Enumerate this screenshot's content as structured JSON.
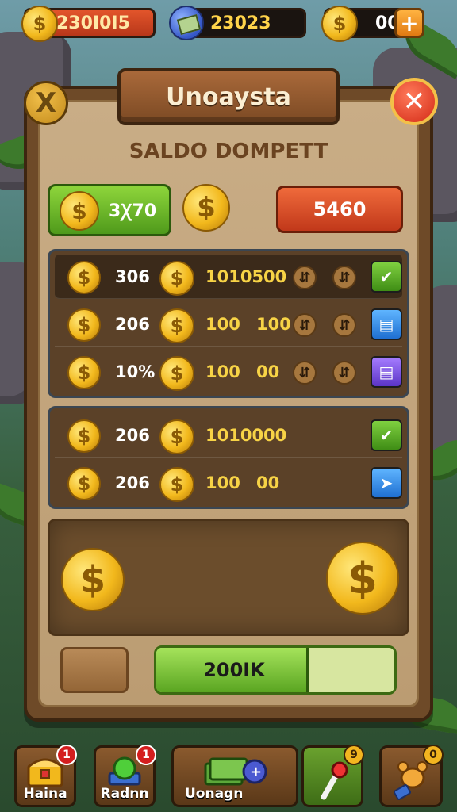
{
  "currencies": {
    "red_amount": "230I0I5",
    "gem_amount": "23023",
    "coin_amount": "00",
    "plus_label": "+"
  },
  "dialog": {
    "title": "Unoaysta",
    "subtitle": "SALDO DOMPETT",
    "close_left_label": "X",
    "close_right_label": "✕",
    "green_button_value": "3Ꭓ70",
    "red_button_value": "5460",
    "coin_symbol": "$"
  },
  "list_group_1": [
    {
      "amount": "306",
      "value": "1010500",
      "value_b": "",
      "action_icon": "check-icon",
      "arrows": true,
      "action_glyph": "✔"
    },
    {
      "amount": "206",
      "value": "100",
      "value_b": "100",
      "action_icon": "card-icon",
      "arrows": true,
      "action_glyph": "▤"
    },
    {
      "amount": "10%",
      "value": "100",
      "value_b": "00",
      "action_icon": "card-icon",
      "arrows": true,
      "action_glyph": "▤"
    }
  ],
  "list_group_2": [
    {
      "amount": "206",
      "value": "1010000",
      "value_b": "",
      "action_icon": "check-icon",
      "arrows": false,
      "action_glyph": "✔"
    },
    {
      "amount": "206",
      "value": "100",
      "value_b": "00",
      "action_icon": "send-icon",
      "arrows": false,
      "action_glyph": "➤"
    }
  ],
  "progress": {
    "label": "200IK",
    "fraction": 0.64
  },
  "nav": [
    {
      "label": "Haina",
      "badge": "1",
      "badge_style": "red",
      "icon": "treasure-chest-icon"
    },
    {
      "label": "Radnn",
      "badge": "1",
      "badge_style": "red",
      "icon": "green-orb-icon"
    },
    {
      "label": "Uonagn",
      "badge": "",
      "badge_style": "",
      "icon": "cash-stack-icon"
    },
    {
      "label": "",
      "badge": "9",
      "badge_style": "gold",
      "icon": "magnifier-icon"
    },
    {
      "label": "",
      "badge": "0",
      "badge_style": "gold",
      "icon": "pet-paw-icon"
    }
  ],
  "colors": {
    "panel_wood": "#6e4a28",
    "panel_parchment": "#c9ad86",
    "accent_green": "#5aa521",
    "accent_red": "#c1381a",
    "gold": "#f2b81c"
  }
}
